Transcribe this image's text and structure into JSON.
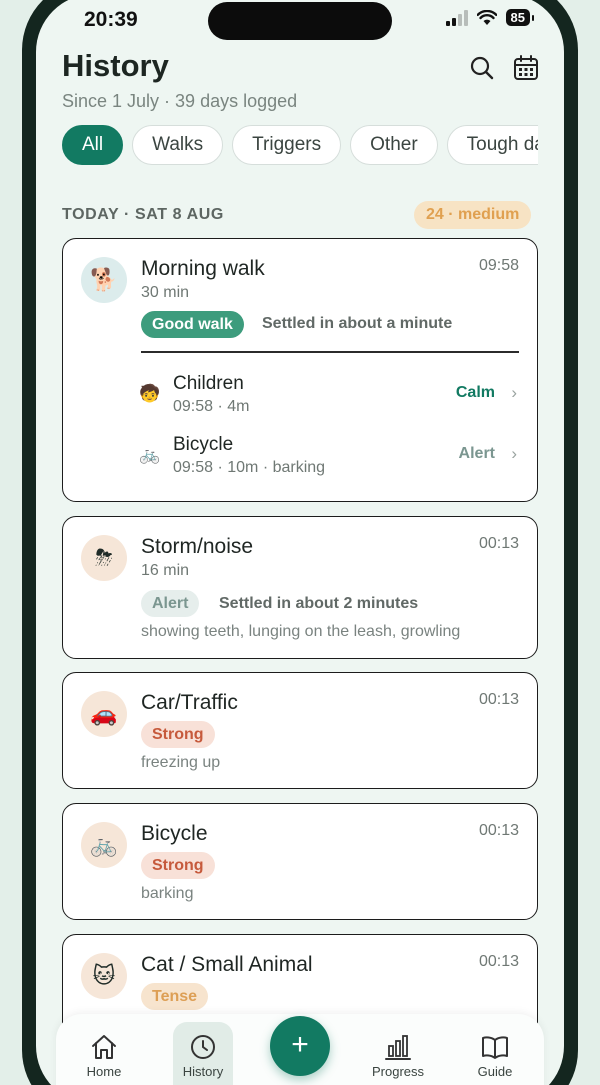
{
  "status_bar": {
    "time": "20:39",
    "battery": "85"
  },
  "header": {
    "title": "History",
    "subtitle": "Since 1 July · 39 days logged",
    "search_icon": "search-icon",
    "calendar_icon": "calendar-icon"
  },
  "filters": [
    {
      "label": "All",
      "active": true
    },
    {
      "label": "Walks",
      "active": false
    },
    {
      "label": "Triggers",
      "active": false
    },
    {
      "label": "Other",
      "active": false
    },
    {
      "label": "Tough days",
      "active": false
    }
  ],
  "day": {
    "label": "TODAY · SAT 8 AUG",
    "badge": "24 · medium"
  },
  "entries": [
    {
      "icon": "dog-icon",
      "title": "Morning walk",
      "time": "09:58",
      "duration": "30 min",
      "pill": "Good walk",
      "settled": "Settled in about a minute",
      "sub_events": [
        {
          "icon": "child-icon",
          "title": "Children",
          "meta": "09:58 · 4m",
          "state": "Calm"
        },
        {
          "icon": "bicycle-icon",
          "title": "Bicycle",
          "meta": "09:58 · 10m · barking",
          "state": "Alert"
        }
      ]
    },
    {
      "icon": "storm-icon",
      "title": "Storm/noise",
      "time": "00:13",
      "duration": "16 min",
      "pill": "Alert",
      "settled": "Settled in about 2 minutes",
      "note": "showing teeth, lunging on the leash, growling"
    },
    {
      "icon": "car-icon",
      "title": "Car/Traffic",
      "time": "00:13",
      "pill": "Strong",
      "note": "freezing up"
    },
    {
      "icon": "bicycle-icon",
      "title": "Bicycle",
      "time": "00:13",
      "pill": "Strong",
      "note": "barking"
    },
    {
      "icon": "cat-icon",
      "title": "Cat / Small Animal",
      "time": "00:13",
      "pill": "Tense"
    }
  ],
  "tabbar": {
    "home": "Home",
    "history": "History",
    "add": "+",
    "progress": "Progress",
    "guide": "Guide"
  },
  "colors": {
    "accent": "#127a62",
    "good": "#3d9c7d",
    "strong": "#c65a3c",
    "tense": "#dd9f55"
  }
}
